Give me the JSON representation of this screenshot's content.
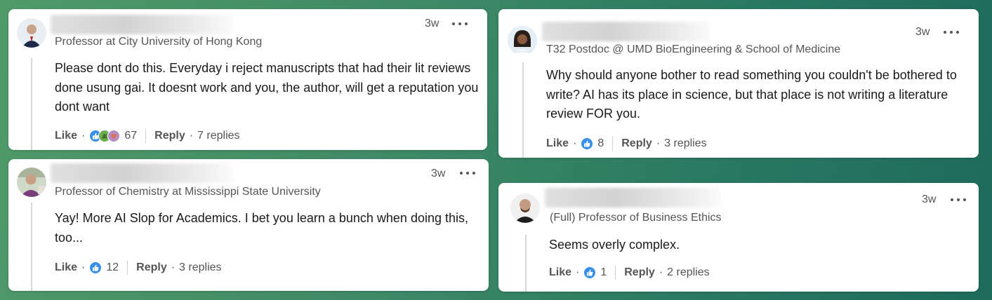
{
  "comments": [
    {
      "time": "3w",
      "headline": "Professor at City University of Hong Kong",
      "body": "Please dont do this. Everyday i reject manuscripts that had their lit reviews done usung gai. It doesnt work and you, the author, will get a reputation you dont want",
      "like_label": "Like",
      "reaction_count": "67",
      "reply_label": "Reply",
      "replies": "7 replies",
      "reactions": [
        "like-reaction-icon",
        "celebrate-reaction-icon",
        "love-reaction-icon"
      ]
    },
    {
      "time": "3w",
      "headline": "Professor of Chemistry at Mississippi State University",
      "body": "Yay! More AI Slop for Academics. I bet you learn a bunch when doing this, too...",
      "like_label": "Like",
      "reaction_count": "12",
      "reply_label": "Reply",
      "replies": "3 replies",
      "reactions": [
        "like-reaction-icon"
      ]
    },
    {
      "time": "3w",
      "headline": "T32 Postdoc @ UMD BioEngineering & School of Medicine",
      "body": "Why should anyone bother to read something you couldn't be bothered to write? AI has its place in science, but that place is not writing a literature review FOR you.",
      "like_label": "Like",
      "reaction_count": "8",
      "reply_label": "Reply",
      "replies": "3 replies",
      "reactions": [
        "like-reaction-icon"
      ]
    },
    {
      "time": "3w",
      "headline": "(Full) Professor of Business Ethics",
      "body": "Seems overly complex.",
      "like_label": "Like",
      "reaction_count": "1",
      "reply_label": "Reply",
      "replies": "2 replies",
      "reactions": [
        "like-reaction-icon"
      ]
    }
  ],
  "colors": {
    "like_blue": "#378fe9",
    "celebrate_green": "#44712e",
    "love_pink": "#df704d"
  }
}
